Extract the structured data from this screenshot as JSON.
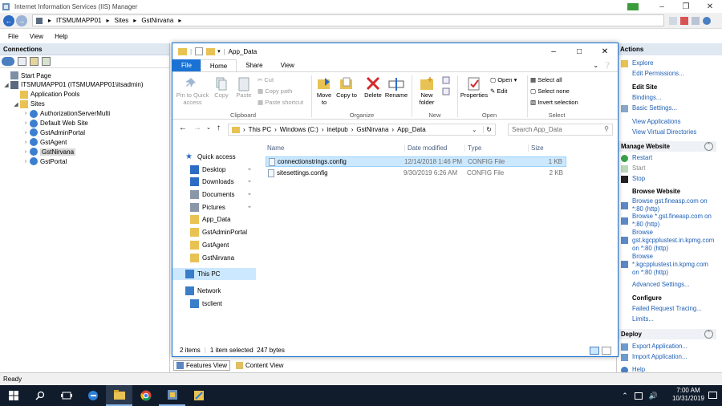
{
  "iis": {
    "title": "Internet Information Services (IIS) Manager",
    "breadcrumb": [
      "ITSMUMAPP01",
      "Sites",
      "GstNirvana"
    ],
    "menu": [
      "File",
      "View",
      "Help"
    ],
    "status": "Ready"
  },
  "connections": {
    "header": "Connections",
    "tree": [
      {
        "label": "Start Page",
        "level": 0,
        "toggle": ""
      },
      {
        "label": "ITSMUMAPP01 (ITSMUMAPP01\\itsadmin)",
        "level": 0,
        "toggle": "◢"
      },
      {
        "label": "Application Pools",
        "level": 1,
        "toggle": ""
      },
      {
        "label": "Sites",
        "level": 1,
        "toggle": "◢"
      },
      {
        "label": "AuthorizationServerMulti",
        "level": 2,
        "toggle": "›"
      },
      {
        "label": "Default Web Site",
        "level": 2,
        "toggle": "›"
      },
      {
        "label": "GstAdminPortal",
        "level": 2,
        "toggle": "›"
      },
      {
        "label": "GstAgent",
        "level": 2,
        "toggle": "›"
      },
      {
        "label": "GstNirvana",
        "level": 2,
        "toggle": "›",
        "selected": true
      },
      {
        "label": "GstPortal",
        "level": 2,
        "toggle": "›"
      }
    ]
  },
  "bottom_tabs": {
    "features": "Features View",
    "content": "Content View"
  },
  "actions": {
    "header": "Actions",
    "explore": "Explore",
    "edit_permissions": "Edit Permissions...",
    "edit_site": "Edit Site",
    "bindings": "Bindings...",
    "basic_settings": "Basic Settings...",
    "view_applications": "View Applications",
    "view_vdirs": "View Virtual Directories",
    "manage_website": "Manage Website",
    "restart": "Restart",
    "start": "Start",
    "stop": "Stop",
    "browse_website": "Browse Website",
    "browse1": "Browse gst.fineasp.com on *:80 (http)",
    "browse2": "Browse *.gst.fineasp.com on *:80 (http)",
    "browse3": "Browse gst.kgcpplustest.in.kpmg.com on *:80 (http)",
    "browse4": "Browse *.kgcpplustest.in.kpmg.com on *:80 (http)",
    "advanced_settings": "Advanced Settings...",
    "configure": "Configure",
    "failed_request": "Failed Request Tracing...",
    "limits": "Limits...",
    "deploy": "Deploy",
    "export_app": "Export Application...",
    "import_app": "Import Application...",
    "help": "Help"
  },
  "explorer": {
    "title": "App_Data",
    "tabs": [
      "File",
      "Home",
      "Share",
      "View"
    ],
    "ribbon": {
      "pin": "Pin to Quick access",
      "copy": "Copy",
      "paste": "Paste",
      "cut": "Cut",
      "copy_path": "Copy path",
      "paste_shortcut": "Paste shortcut",
      "clipboard": "Clipboard",
      "move_to": "Move to",
      "copy_to": "Copy to",
      "delete": "Delete",
      "rename": "Rename",
      "organize": "Organize",
      "new_folder": "New folder",
      "new": "New",
      "properties": "Properties",
      "open": "Open",
      "edit": "Edit",
      "open_group": "Open",
      "select_all": "Select all",
      "select_none": "Select none",
      "invert": "Invert selection",
      "select": "Select"
    },
    "path": [
      "This PC",
      "Windows (C:)",
      "inetpub",
      "GstNirvana",
      "App_Data"
    ],
    "search_placeholder": "Search App_Data",
    "nav": [
      {
        "label": "Quick access",
        "icon": "star-icon"
      },
      {
        "label": "Desktop",
        "icon": "desktop-icon"
      },
      {
        "label": "Downloads",
        "icon": "download-icon"
      },
      {
        "label": "Documents",
        "icon": "document-icon"
      },
      {
        "label": "Pictures",
        "icon": "picture-icon"
      },
      {
        "label": "App_Data",
        "icon": "folder-icon"
      },
      {
        "label": "GstAdminPortal",
        "icon": "folder-icon"
      },
      {
        "label": "GstAgent",
        "icon": "folder-icon"
      },
      {
        "label": "GstNirvana",
        "icon": "folder-icon"
      },
      {
        "label": "This PC",
        "icon": "computer-icon"
      },
      {
        "label": "Network",
        "icon": "network-icon"
      },
      {
        "label": "tsclient",
        "icon": "drive-icon"
      }
    ],
    "columns": [
      "Name",
      "Date modified",
      "Type",
      "Size"
    ],
    "files": [
      {
        "name": "connectionstrings.config",
        "date": "12/14/2018 1:46 PM",
        "type": "CONFIG File",
        "size": "1 KB"
      },
      {
        "name": "sitesettings.config",
        "date": "9/30/2019 6:26 AM",
        "type": "CONFIG File",
        "size": "2 KB"
      }
    ],
    "status_items": "2 items",
    "status_selected": "1 item selected  247 bytes"
  },
  "taskbar": {
    "time": "7:00 AM",
    "date": "10/31/2019"
  },
  "colors": {
    "accent": "#1a73d4",
    "selection": "#cce8ff",
    "link": "#1e5fb4",
    "taskbar": "#101c2c"
  }
}
